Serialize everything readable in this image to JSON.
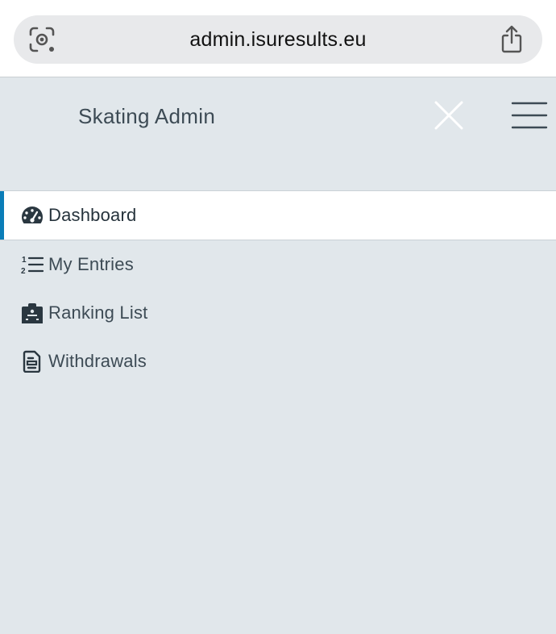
{
  "browser": {
    "url": "admin.isuresults.eu"
  },
  "header": {
    "title": "Skating Admin"
  },
  "nav": {
    "items": [
      {
        "label": "Dashboard",
        "icon": "gauge-icon",
        "active": true
      },
      {
        "label": "My Entries",
        "icon": "ordered-list-icon",
        "active": false
      },
      {
        "label": "Ranking List",
        "icon": "clipboard-icon",
        "active": false
      },
      {
        "label": "Withdrawals",
        "icon": "document-icon",
        "active": false
      }
    ]
  },
  "colors": {
    "accent": "#0a7db8",
    "background": "#e1e7eb",
    "text": "#3d4b55"
  }
}
